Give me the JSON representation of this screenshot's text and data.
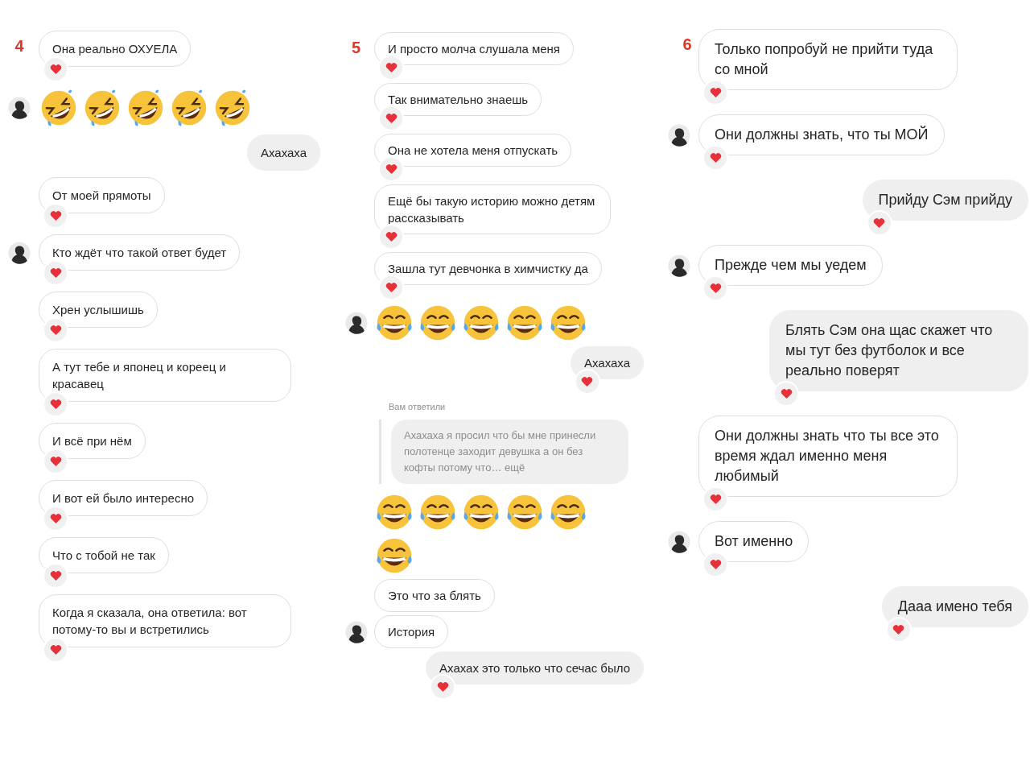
{
  "columns": [
    {
      "number": "4",
      "messages": [
        {
          "kind": "received",
          "avatar": false,
          "liked": true,
          "text": "Она реально ОХУЕЛА"
        },
        {
          "kind": "emoji",
          "avatar": true,
          "emojis": [
            {
              "kind": "rofl"
            },
            {
              "kind": "rofl"
            },
            {
              "kind": "rofl"
            },
            {
              "kind": "rofl"
            },
            {
              "kind": "rofl"
            }
          ]
        },
        {
          "kind": "sent",
          "liked": false,
          "text": "Ахахаха"
        },
        {
          "kind": "received",
          "avatar": false,
          "liked": true,
          "text": "От моей прямоты"
        },
        {
          "kind": "received",
          "avatar": true,
          "liked": true,
          "text": "Кто ждёт что такой ответ будет"
        },
        {
          "kind": "received",
          "avatar": false,
          "liked": true,
          "text": "Хрен услышишь"
        },
        {
          "kind": "received",
          "avatar": false,
          "liked": true,
          "text": "А тут тебе и японец и кореец и красавец"
        },
        {
          "kind": "received",
          "avatar": false,
          "liked": true,
          "text": "И всё при нём"
        },
        {
          "kind": "received",
          "avatar": false,
          "liked": true,
          "text": "И вот ей было интересно"
        },
        {
          "kind": "received",
          "avatar": false,
          "liked": true,
          "text": "Что с тобой не так"
        },
        {
          "kind": "received",
          "avatar": false,
          "liked": true,
          "text": "Когда я сказала, она ответила: вот потому-то вы и встретились"
        }
      ]
    },
    {
      "number": "5",
      "messages": [
        {
          "kind": "received",
          "avatar": false,
          "liked": true,
          "text": "И просто молча слушала меня"
        },
        {
          "kind": "received",
          "avatar": false,
          "liked": true,
          "text": "Так внимательно знаешь"
        },
        {
          "kind": "received",
          "avatar": false,
          "liked": true,
          "text": "Она не хотела меня отпускать"
        },
        {
          "kind": "received",
          "avatar": false,
          "liked": true,
          "text": "Ещё бы такую историю можно детям рассказывать"
        },
        {
          "kind": "received",
          "avatar": false,
          "liked": true,
          "text": "Зашла тут девчонка в химчистку да"
        },
        {
          "kind": "emoji",
          "avatar": true,
          "emojis": [
            {
              "kind": "joy"
            },
            {
              "kind": "joy"
            },
            {
              "kind": "joy"
            },
            {
              "kind": "joy"
            },
            {
              "kind": "joy"
            }
          ]
        },
        {
          "kind": "sent",
          "liked": true,
          "text": "Ахахаха"
        },
        {
          "kind": "reply",
          "label": "Вам ответили",
          "text": "Ахахаха  я просил что бы мне принесли полотенце заходит девушка а он без кофты потому что… ещё"
        },
        {
          "kind": "emoji",
          "avatar": false,
          "emojis": [
            {
              "kind": "joy"
            },
            {
              "kind": "joy"
            },
            {
              "kind": "joy"
            },
            {
              "kind": "joy"
            },
            {
              "kind": "joy"
            }
          ]
        },
        {
          "kind": "emoji",
          "avatar": false,
          "emojis": [
            {
              "kind": "joy"
            }
          ]
        },
        {
          "kind": "received",
          "avatar": false,
          "liked": false,
          "text": "Это что за блять"
        },
        {
          "kind": "received",
          "avatar": true,
          "liked": false,
          "text": "История"
        },
        {
          "kind": "sent",
          "liked": true,
          "text": "Ахахах  это только что сечас было"
        }
      ]
    },
    {
      "number": "6",
      "messages": [
        {
          "kind": "received",
          "avatar": false,
          "liked": true,
          "text": "Только попробуй не прийти туда со мной"
        },
        {
          "kind": "received",
          "avatar": true,
          "liked": true,
          "text": "Они должны знать, что ты МОЙ"
        },
        {
          "kind": "sent",
          "liked": true,
          "text": "Прийду Сэм прийду"
        },
        {
          "kind": "received",
          "avatar": true,
          "liked": true,
          "text": "Прежде чем мы уедем"
        },
        {
          "kind": "sent",
          "liked": true,
          "text": "Блять Сэм она щас скажет что мы тут без футболок и все реально поверят"
        },
        {
          "kind": "received",
          "avatar": false,
          "liked": true,
          "text": "Они должны знать что ты все это время ждал именно меня любимый"
        },
        {
          "kind": "received",
          "avatar": true,
          "liked": true,
          "text": "Вот именно"
        },
        {
          "kind": "sent",
          "liked": true,
          "text": "Дааа имено тебя"
        }
      ]
    }
  ]
}
